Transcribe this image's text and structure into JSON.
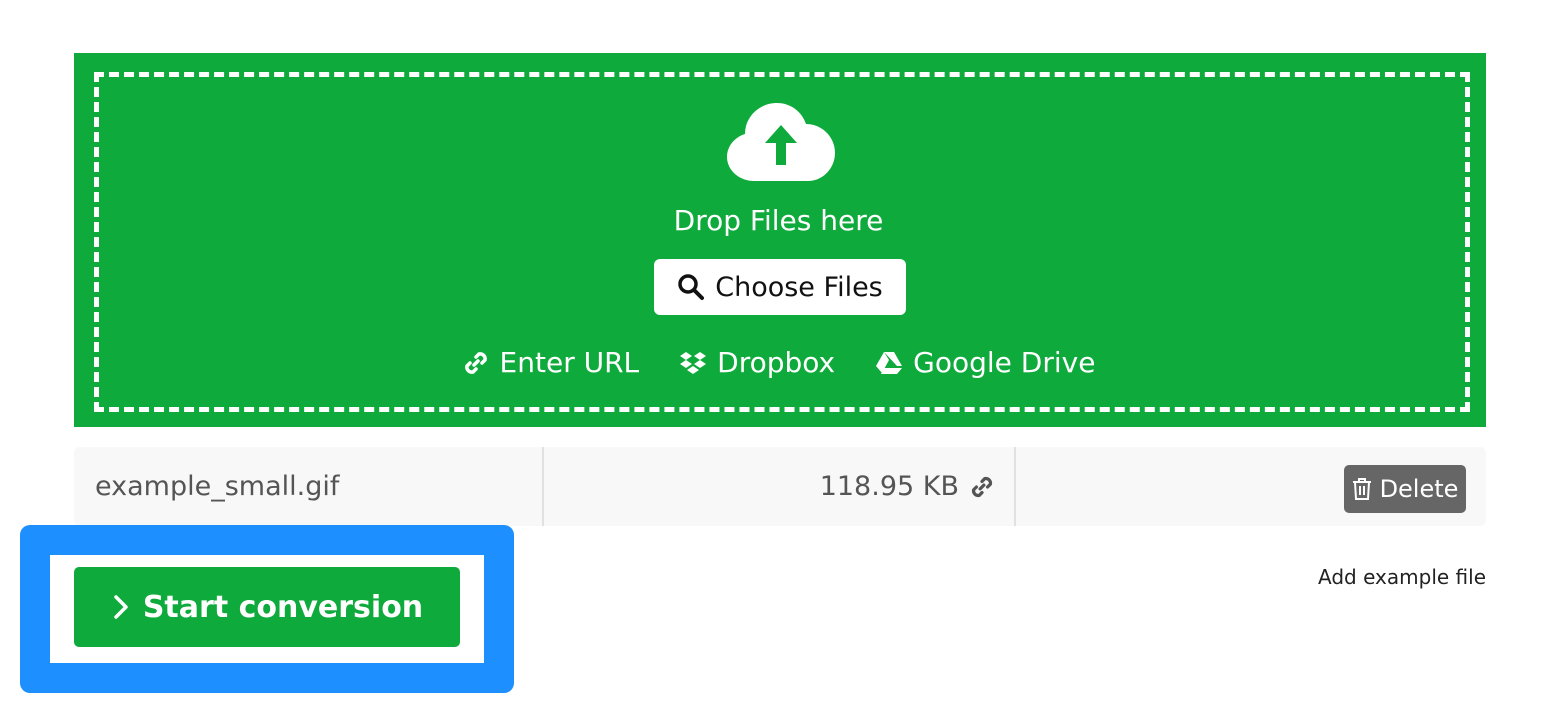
{
  "upload": {
    "drop_text": "Drop Files here",
    "choose_label": "Choose Files",
    "links": [
      {
        "label": "Enter URL",
        "icon": "link-icon"
      },
      {
        "label": "Dropbox",
        "icon": "dropbox-icon"
      },
      {
        "label": "Google Drive",
        "icon": "google-drive-icon"
      }
    ],
    "background_color": "#0faa3c"
  },
  "file": {
    "name": "example_small.gif",
    "size": "118.95 KB",
    "delete_label": "Delete"
  },
  "actions": {
    "start_label": "Start conversion",
    "add_example_label": "Add example file"
  },
  "colors": {
    "accent_green": "#0faa3c",
    "highlight_blue": "#1e8fff",
    "delete_gray": "#666666"
  }
}
